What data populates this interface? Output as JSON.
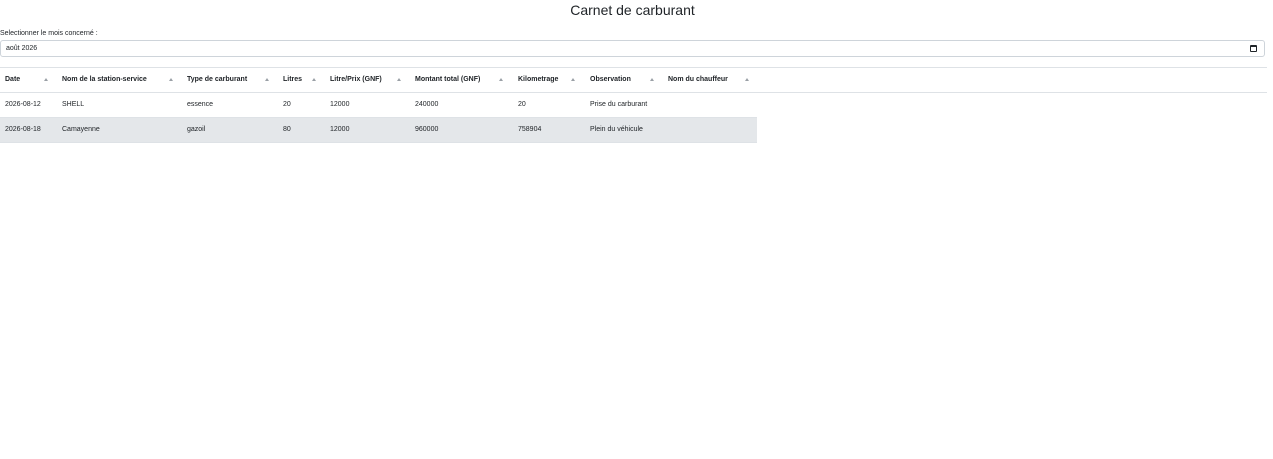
{
  "page": {
    "title": "Carnet de carburant"
  },
  "filter": {
    "label": "Selectionner le mois concerné :",
    "month_value": "août 2026",
    "icon": "calendar-icon"
  },
  "table": {
    "columns": [
      "Date",
      "Nom de la station-service",
      "Type de carburant",
      "Litres",
      "Litre/Prix (GNF)",
      "Montant total (GNF)",
      "Kilometrage",
      "Observation",
      "Nom du chauffeur"
    ],
    "sort_icon": "sort-up-icon",
    "rows": [
      [
        "2026-08-12",
        "SHELL",
        "essence",
        "20",
        "12000",
        "240000",
        "20",
        "Prise du carburant",
        ""
      ],
      [
        "2026-08-18",
        "Camayenne",
        "gazoil",
        "80",
        "12000",
        "960000",
        "758904",
        "Plein du véhicule",
        ""
      ]
    ],
    "highlight_color": "#e4e7ea"
  }
}
